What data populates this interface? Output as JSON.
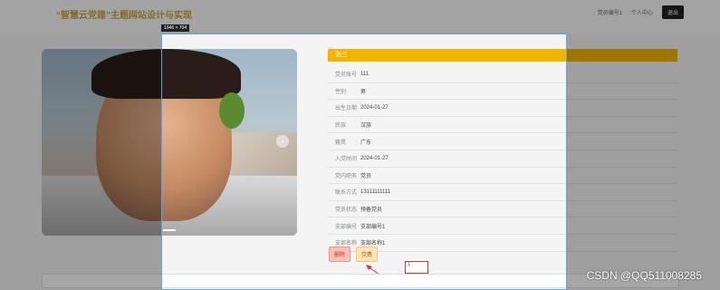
{
  "header": {
    "title": "“智慧云党建”主题网站设计与实现",
    "nav": [
      "党员编号1",
      "个人中心"
    ],
    "exit_label": "退出"
  },
  "size_badge": "1046 × 704",
  "member": {
    "name": "张三",
    "fields": [
      {
        "label": "党员账号",
        "value": "111"
      },
      {
        "label": "性别",
        "value": "男"
      },
      {
        "label": "出生日期",
        "value": "2024-01-27"
      },
      {
        "label": "民族",
        "value": "汉族"
      },
      {
        "label": "籍贯",
        "value": "广东"
      },
      {
        "label": "入党时间",
        "value": "2024-01-27"
      },
      {
        "label": "党内职务",
        "value": "党员"
      },
      {
        "label": "联系方式",
        "value": "13111111111"
      },
      {
        "label": "党员状态",
        "value": "预备党员"
      },
      {
        "label": "支部编号",
        "value": "支部编号1"
      },
      {
        "label": "支部名称",
        "value": "支部名称1"
      }
    ]
  },
  "actions": {
    "delete_label": "删除",
    "favorite_label": "党费"
  },
  "input_value": "1",
  "watermark": "CSDN @QQ511008285",
  "colors": {
    "accent": "#f2b400",
    "title": "#c9a640"
  }
}
